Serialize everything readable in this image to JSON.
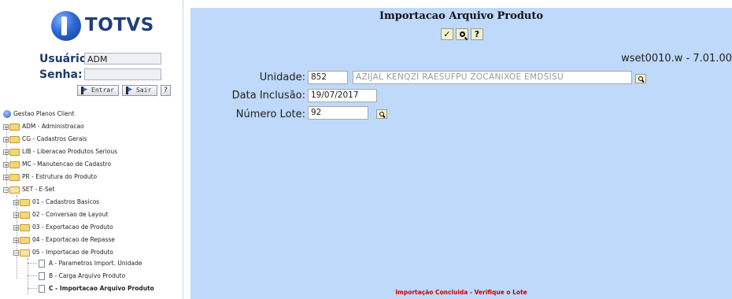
{
  "brand": {
    "logo_text": "TOTVS"
  },
  "login": {
    "user_label": "Usuário:",
    "user_value": "ADM",
    "password_label": "Senha:",
    "password_value": "",
    "enter_label": "Entrar",
    "exit_label": "Sair",
    "help_label": "?"
  },
  "tree": {
    "root": "Gestao Planos Client",
    "items": [
      "ADM - Administracao",
      "CG - Cadastros Gerais",
      "LIB - Liberacao Produtos Serious",
      "MC - Manutencao de Cadastro",
      "PR - Estrutura do Produto",
      "SET - E-Set"
    ],
    "set_children": [
      "01 - Cadastros Basicos",
      "02 - Conversao de Layout",
      "03 - Exportacao de Produto",
      "04 - Exportacao de Repasse",
      "05 - Importacao de Produto"
    ],
    "import_children": [
      "A - Parametros Import. Unidade",
      "B - Carga Arquivo Produto",
      "C - Importacao Arquivo Produto"
    ]
  },
  "form": {
    "title": "Importacao Arquivo Produto",
    "toolbar": {
      "confirm": "✓",
      "help": "?"
    },
    "version": "wset0010.w - 7.01.00",
    "unidade_label": "Unidade:",
    "unidade_code": "852",
    "unidade_name": "AZIJAL KENQZI RAESUFPU ZOCANIXOE EMDSISU",
    "data_label": "Data Inclusão:",
    "data_value": "19/07/2017",
    "lote_label": "Número Lote:",
    "lote_value": "92",
    "status_message": "Importação Concluida - Verifique o Lote"
  },
  "colors": {
    "panel_bg": "#bfd9fb",
    "status": "#d10000",
    "label_blue": "#1d3a6a"
  }
}
